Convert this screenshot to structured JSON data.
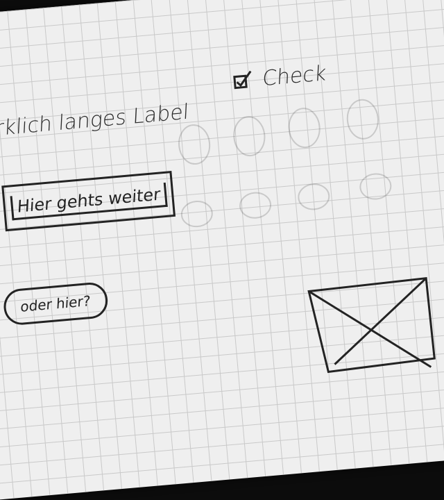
{
  "sketch": {
    "label_text": "irklich langes Label",
    "checkbox": {
      "label": "Check",
      "checked": true
    },
    "primary_button": {
      "label": "Hier gehts weiter"
    },
    "secondary_button": {
      "label": "oder hier?"
    },
    "image_placeholder": {
      "icon": "image-placeholder-cross"
    }
  },
  "colors": {
    "paper": "#efefef",
    "grid": "#c9c9c9",
    "ink": "#232323",
    "background": "#0c0c0c"
  }
}
